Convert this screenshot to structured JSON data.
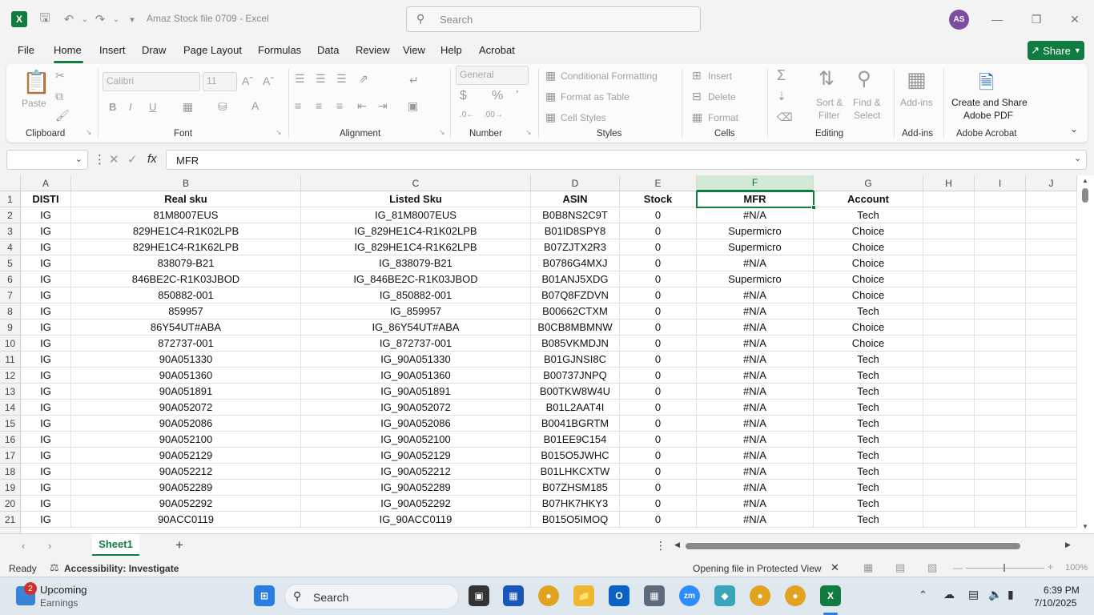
{
  "window": {
    "title": "Amaz Stock file 0709  -  Excel",
    "search_placeholder": "Search",
    "user_initials": "AS"
  },
  "menu": {
    "tabs": [
      "File",
      "Home",
      "Insert",
      "Draw",
      "Page Layout",
      "Formulas",
      "Data",
      "Review",
      "View",
      "Help",
      "Acrobat"
    ],
    "active": "Home",
    "share_label": "Share"
  },
  "ribbon": {
    "clipboard": {
      "label": "Clipboard",
      "paste": "Paste"
    },
    "font": {
      "label": "Font",
      "font_name": "Calibri",
      "font_size": "11",
      "bold": "B",
      "italic": "I",
      "underline": "U"
    },
    "alignment": {
      "label": "Alignment"
    },
    "number": {
      "label": "Number",
      "format": "General"
    },
    "styles": {
      "label": "Styles",
      "conditional": "Conditional Formatting",
      "format_table": "Format as Table",
      "cell_styles": "Cell Styles"
    },
    "cells": {
      "label": "Cells",
      "insert": "Insert",
      "delete": "Delete",
      "format": "Format"
    },
    "editing": {
      "label": "Editing",
      "sort_filter_1": "Sort &",
      "sort_filter_2": "Filter",
      "find_select_1": "Find &",
      "find_select_2": "Select"
    },
    "addins": {
      "label": "Add-ins",
      "button": "Add-ins"
    },
    "acrobat": {
      "label": "Adobe Acrobat",
      "button_1": "Create and Share",
      "button_2": "Adobe PDF"
    }
  },
  "formula_bar": {
    "name_box": "",
    "fx": "fx",
    "value": "MFR"
  },
  "sheet": {
    "columns": [
      "A",
      "B",
      "C",
      "D",
      "E",
      "F",
      "G",
      "H",
      "I",
      "J"
    ],
    "selected_column": "F",
    "selected_cell": "F1",
    "headers": [
      "DISTI",
      "Real sku",
      "Listed Sku",
      "ASIN",
      "Stock",
      "MFR",
      "Account"
    ],
    "rows": [
      [
        "IG",
        "81M8007EUS",
        "IG_81M8007EUS",
        "B0B8NS2C9T",
        "0",
        "#N/A",
        "Tech"
      ],
      [
        "IG",
        "829HE1C4-R1K02LPB",
        "IG_829HE1C4-R1K02LPB",
        "B01ID8SPY8",
        "0",
        "Supermicro",
        "Choice"
      ],
      [
        "IG",
        "829HE1C4-R1K62LPB",
        "IG_829HE1C4-R1K62LPB",
        "B07ZJTX2R3",
        "0",
        "Supermicro",
        "Choice"
      ],
      [
        "IG",
        "838079-B21",
        "IG_838079-B21",
        "B0786G4MXJ",
        "0",
        "#N/A",
        "Choice"
      ],
      [
        "IG",
        "846BE2C-R1K03JBOD",
        "IG_846BE2C-R1K03JBOD",
        "B01ANJ5XDG",
        "0",
        "Supermicro",
        "Choice"
      ],
      [
        "IG",
        "850882-001",
        "IG_850882-001",
        "B07Q8FZDVN",
        "0",
        "#N/A",
        "Choice"
      ],
      [
        "IG",
        "859957",
        "IG_859957",
        "B00662CTXM",
        "0",
        "#N/A",
        "Tech"
      ],
      [
        "IG",
        "86Y54UT#ABA",
        "IG_86Y54UT#ABA",
        "B0CB8MBMNW",
        "0",
        "#N/A",
        "Choice"
      ],
      [
        "IG",
        "872737-001",
        "IG_872737-001",
        "B085VKMDJN",
        "0",
        "#N/A",
        "Choice"
      ],
      [
        "IG",
        "90A051330",
        "IG_90A051330",
        "B01GJNSI8C",
        "0",
        "#N/A",
        "Tech"
      ],
      [
        "IG",
        "90A051360",
        "IG_90A051360",
        "B00737JNPQ",
        "0",
        "#N/A",
        "Tech"
      ],
      [
        "IG",
        "90A051891",
        "IG_90A051891",
        "B00TKW8W4U",
        "0",
        "#N/A",
        "Tech"
      ],
      [
        "IG",
        "90A052072",
        "IG_90A052072",
        "B01L2AAT4I",
        "0",
        "#N/A",
        "Tech"
      ],
      [
        "IG",
        "90A052086",
        "IG_90A052086",
        "B0041BGRTM",
        "0",
        "#N/A",
        "Tech"
      ],
      [
        "IG",
        "90A052100",
        "IG_90A052100",
        "B01EE9C154",
        "0",
        "#N/A",
        "Tech"
      ],
      [
        "IG",
        "90A052129",
        "IG_90A052129",
        "B015O5JWHC",
        "0",
        "#N/A",
        "Tech"
      ],
      [
        "IG",
        "90A052212",
        "IG_90A052212",
        "B01LHKCXTW",
        "0",
        "#N/A",
        "Tech"
      ],
      [
        "IG",
        "90A052289",
        "IG_90A052289",
        "B07ZHSM185",
        "0",
        "#N/A",
        "Tech"
      ],
      [
        "IG",
        "90A052292",
        "IG_90A052292",
        "B07HK7HKY3",
        "0",
        "#N/A",
        "Tech"
      ],
      [
        "IG",
        "90ACC0119",
        "IG_90ACC0119",
        "B015O5IMOQ",
        "0",
        "#N/A",
        "Tech"
      ]
    ],
    "tab_name": "Sheet1"
  },
  "status": {
    "ready": "Ready",
    "accessibility": "Accessibility: Investigate",
    "notice": "Opening file in Protected View",
    "zoom": "100%"
  },
  "taskbar": {
    "widget_badge": "2",
    "widget_title": "Upcoming",
    "widget_sub": "Earnings",
    "search": "Search",
    "zoom_label": "zm",
    "time": "6:39 PM",
    "date": "7/10/2025"
  },
  "colors": {
    "accent": "#107c41",
    "taskbar": "#dfe7ef"
  }
}
